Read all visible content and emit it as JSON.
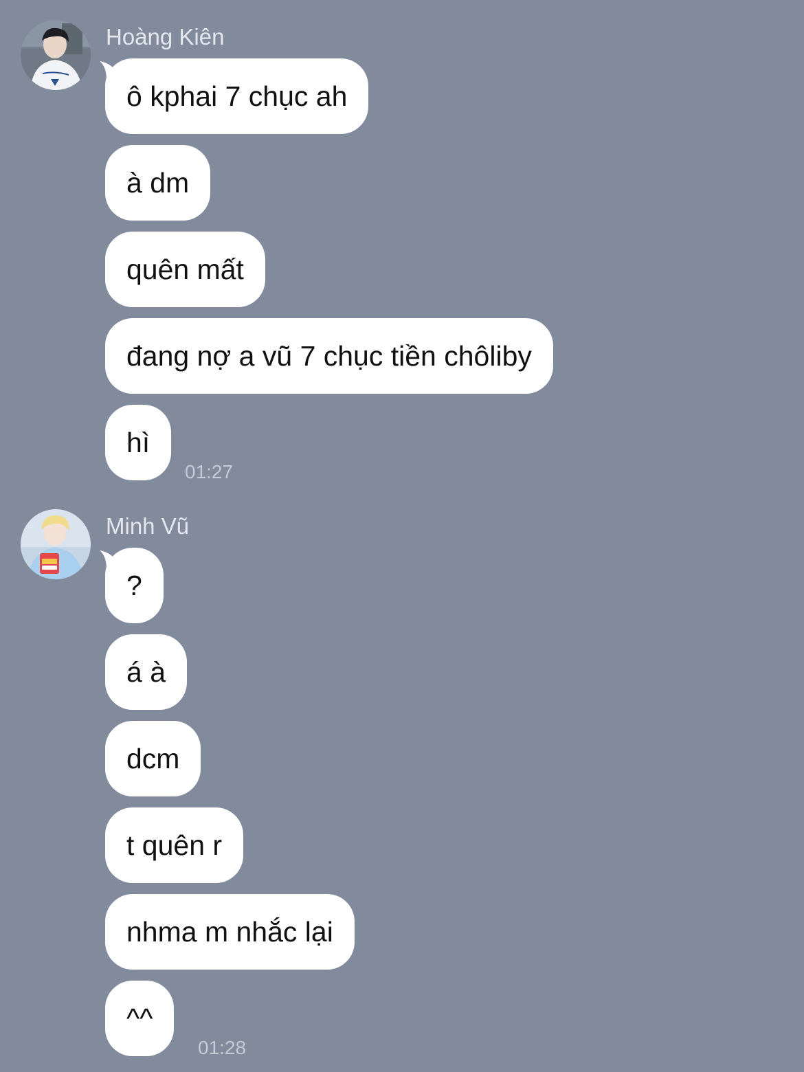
{
  "colors": {
    "background": "#828b9c",
    "bubble": "#ffffff",
    "sender_name": "#e4e7ee",
    "timestamp": "#c5cad4"
  },
  "groups": [
    {
      "sender": "Hoàng Kiên",
      "avatar_icon": "user-avatar-icon",
      "messages": [
        "ô kphai 7 chục ah",
        "à dm",
        "quên mất",
        "đang nợ a vũ 7 chục tiền chôliby",
        "hì"
      ],
      "time": "01:27"
    },
    {
      "sender": "Minh Vũ",
      "avatar_icon": "user-avatar-icon",
      "messages": [
        "?",
        "á à",
        "dcm",
        "t quên r",
        "nhma m nhắc lại",
        "^^"
      ],
      "time": "01:28"
    }
  ]
}
